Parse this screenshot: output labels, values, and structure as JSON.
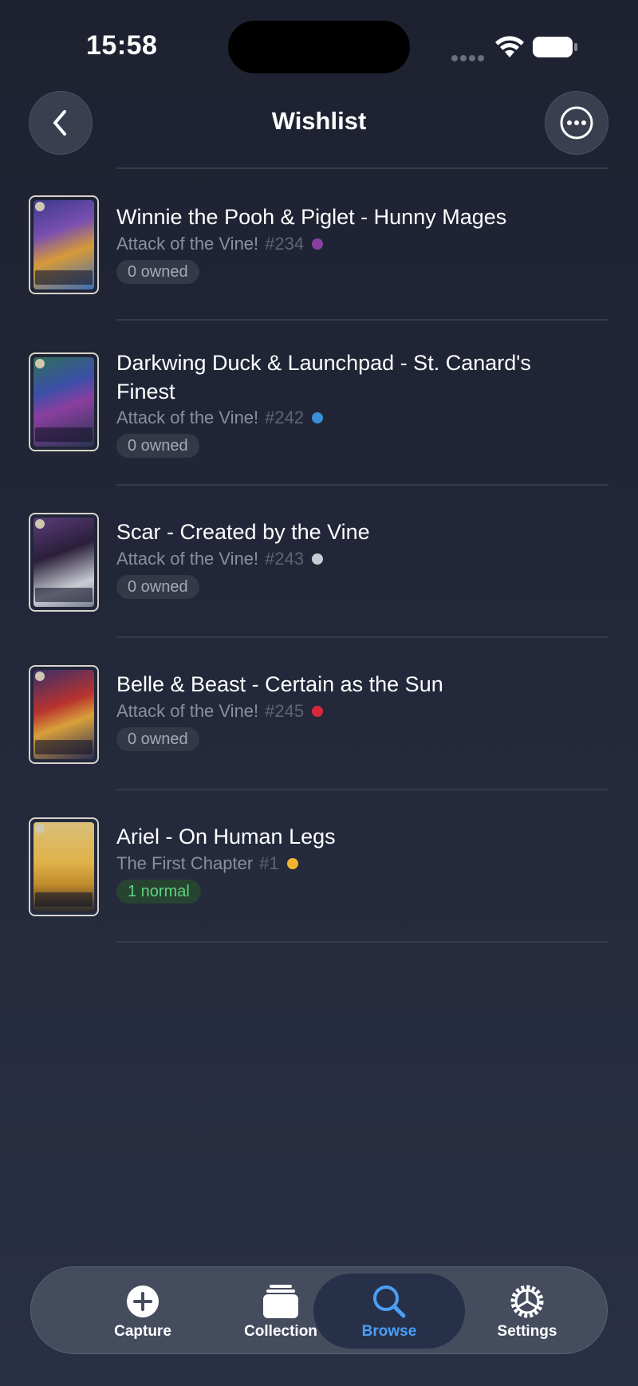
{
  "status_bar": {
    "time": "15:58"
  },
  "header": {
    "title": "Wishlist"
  },
  "cards": [
    {
      "name": "Winnie the Pooh & Piglet - Hunny Mages",
      "set": "Attack of the Vine!",
      "number": "#234",
      "ink_color": "#8a3fa0",
      "owned": "0 owned",
      "owned_state": "none"
    },
    {
      "name": "Darkwing Duck & Launchpad - St. Canard's Finest",
      "set": "Attack of the Vine!",
      "number": "#242",
      "ink_color": "#3a8fd8",
      "owned": "0 owned",
      "owned_state": "none"
    },
    {
      "name": "Scar - Created by the Vine",
      "set": "Attack of the Vine!",
      "number": "#243",
      "ink_color": "#c9ccd3",
      "owned": "0 owned",
      "owned_state": "none"
    },
    {
      "name": "Belle & Beast - Certain as the Sun",
      "set": "Attack of the Vine!",
      "number": "#245",
      "ink_color": "#d8283c",
      "owned": "0 owned",
      "owned_state": "none"
    },
    {
      "name": "Ariel - On Human Legs",
      "set": "The First Chapter",
      "number": "#1",
      "ink_color": "#f2b531",
      "owned": "1 normal",
      "owned_state": "owned"
    }
  ],
  "tabs": [
    {
      "label": "Capture",
      "icon": "plus-circle-icon",
      "active": false
    },
    {
      "label": "Collection",
      "icon": "card-stack-icon",
      "active": false
    },
    {
      "label": "Browse",
      "icon": "search-icon",
      "active": true
    },
    {
      "label": "Settings",
      "icon": "gear-icon",
      "active": false
    }
  ],
  "colors": {
    "accent": "#4a9ff5",
    "owned_green": "#5fd37e",
    "background": "#23283a"
  }
}
